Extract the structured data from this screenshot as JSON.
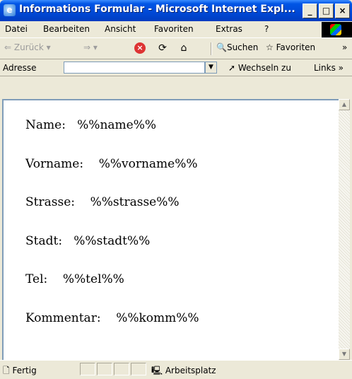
{
  "window": {
    "title": "Informations Formular - Microsoft Internet Expl...",
    "controls": [
      "_",
      "□",
      "×"
    ]
  },
  "menu": {
    "items": [
      "Datei",
      "Bearbeiten",
      "Ansicht",
      "Favoriten",
      "Extras",
      "?"
    ]
  },
  "toolbar": {
    "back_label": "Zurück",
    "search_label": "Suchen",
    "favorites_label": "Favoriten",
    "more": "»"
  },
  "address": {
    "label": "Adresse",
    "value": "",
    "go_label": "Wechseln zu",
    "links_label": "Links",
    "links_more": "»"
  },
  "page": {
    "rows": [
      {
        "label": "Name:",
        "value": "%%name%%"
      },
      {
        "label": "Vorname:",
        "value": "%%vorname%%"
      },
      {
        "label": "Strasse:",
        "value": "%%strasse%%"
      },
      {
        "label": "Stadt:",
        "value": "%%stadt%%"
      },
      {
        "label": "Tel:",
        "value": "%%tel%%"
      },
      {
        "label": "Kommentar:",
        "value": "%%komm%%"
      }
    ]
  },
  "status": {
    "left_text": "Fertig",
    "zone_text": "Arbeitsplatz"
  }
}
